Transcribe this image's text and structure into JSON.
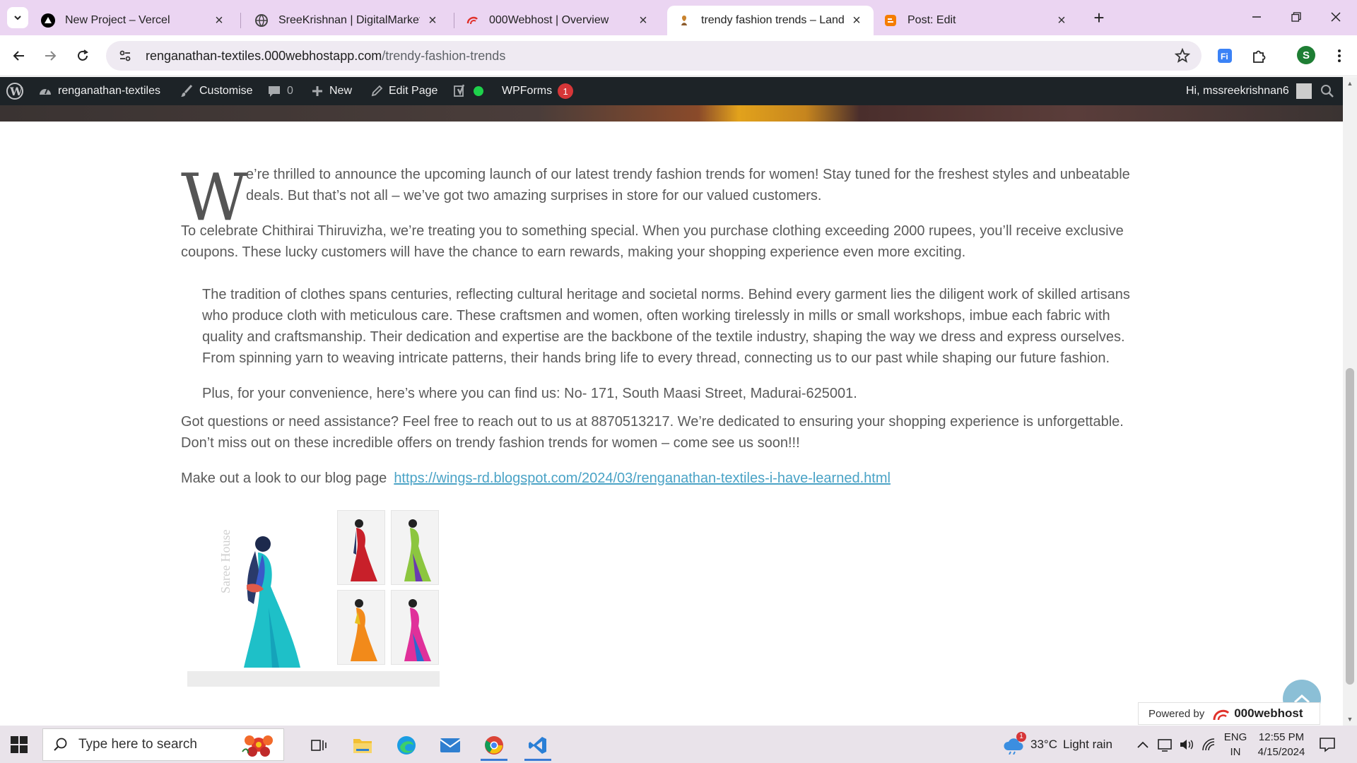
{
  "browser": {
    "tabs": [
      {
        "title": "New Project – Vercel",
        "active": false,
        "icon": "vercel-icon"
      },
      {
        "title": "SreeKrishnan | DigitalMarketter",
        "active": false,
        "icon": "globe-icon"
      },
      {
        "title": "000Webhost | Overview",
        "active": false,
        "icon": "000webhost-icon"
      },
      {
        "title": "trendy fashion trends – Landma",
        "active": true,
        "icon": "site-favicon-icon"
      },
      {
        "title": "Post: Edit",
        "active": false,
        "icon": "blogger-icon"
      }
    ],
    "address": {
      "domain": "renganathan-textiles.000webhostapp.com",
      "path": "/trendy-fashion-trends"
    },
    "profile_initial": "S"
  },
  "adminbar": {
    "site_name": "renganathan-textiles",
    "customise": "Customise",
    "comments_count": "0",
    "new_label": "New",
    "edit_page": "Edit Page",
    "wpforms": "WPForms",
    "wpforms_badge": "1",
    "greeting": "Hi, mssreekrishnan6"
  },
  "article": {
    "dropcap": "W",
    "p1": "e’re thrilled to announce the upcoming launch of our latest trendy fashion trends for women! Stay tuned for the freshest styles and unbeatable deals. But that’s not all – we’ve got two amazing surprises in store for our valued customers.",
    "p2": "To celebrate Chithirai Thiruvizha, we’re treating you to something special. When you purchase clothing exceeding 2000 rupees, you’ll receive exclusive coupons. These lucky customers will have the chance to earn rewards, making your shopping experience even more exciting.",
    "quote1": "The tradition of clothes spans centuries, reflecting cultural heritage and societal norms. Behind every garment lies the diligent work of skilled artisans who produce cloth with meticulous care. These craftsmen and women, often working tirelessly in mills or small workshops, imbue each fabric with quality and craftsmanship. Their dedication and expertise are the backbone of the textile industry, shaping the way we dress and express ourselves. From spinning yarn to weaving intricate patterns, their hands bring life to every thread, connecting us to our past while shaping our future fashion.",
    "quote2": "Plus, for your convenience, here’s where you can find us: No- 171, South Maasi Street, Madurai-625001.",
    "p3": "Got questions or need assistance? Feel free to reach out to us at 8870513217. We’re dedicated to ensuring your shopping experience is unforgettable. Don’t miss out on these incredible offers on trendy fashion trends for women – come see us soon!!!",
    "blog_label": "Make out a look to our blog page",
    "blog_link": "https://wings-rd.blogspot.com/2024/03/renganathan-textiles-i-have-learned.html",
    "image_watermark": "Saree House"
  },
  "footer": {
    "powered_by": "Powered by",
    "brand": "000webhost"
  },
  "taskbar": {
    "search_placeholder": "Type here to search",
    "weather_temp": "33°C",
    "weather_desc": "Light rain",
    "weather_badge": "1",
    "lang_top": "ENG",
    "lang_bottom": "IN",
    "time": "12:55 PM",
    "date": "4/15/2024"
  },
  "colors": {
    "tabstrip": "#ebd5f2",
    "adminbar": "#1d2327",
    "link": "#4aa3c6",
    "badge": "#d63638",
    "status_dot": "#1ed14b"
  }
}
